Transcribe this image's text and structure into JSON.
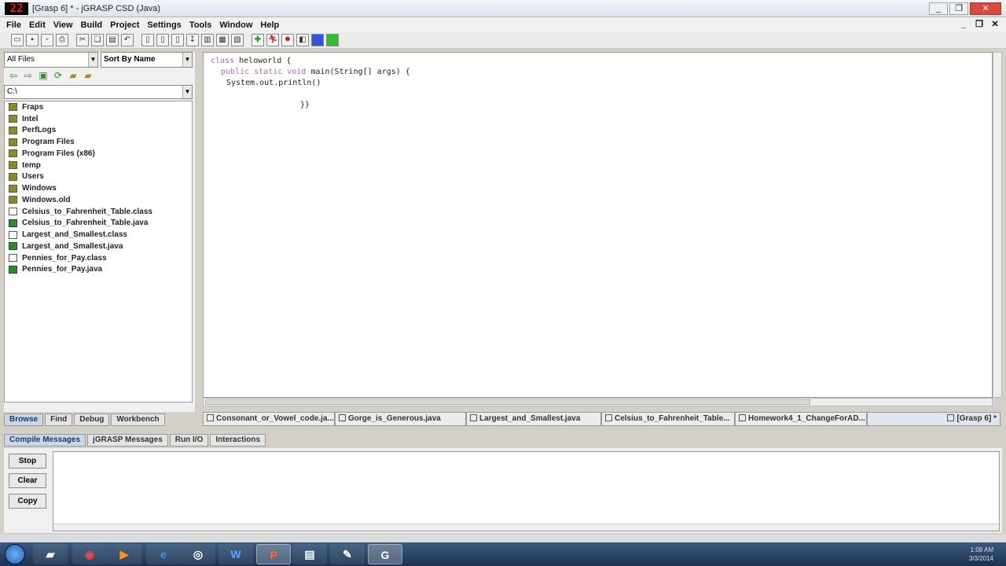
{
  "window": {
    "app_icon_text": "22",
    "title": "[Grasp 6] * - jGRASP CSD (Java)",
    "minimize": "_",
    "restore": "❐",
    "close": "✕"
  },
  "menu": [
    "File",
    "Edit",
    "View",
    "Build",
    "Project",
    "Settings",
    "Tools",
    "Window",
    "Help"
  ],
  "browser": {
    "filter": "All Files",
    "sort": "Sort By Name",
    "path": "C:\\",
    "items": [
      {
        "name": "Fraps",
        "type": "folder"
      },
      {
        "name": "Intel",
        "type": "folder"
      },
      {
        "name": "PerfLogs",
        "type": "folder"
      },
      {
        "name": "Program Files",
        "type": "folder"
      },
      {
        "name": "Program Files (x86)",
        "type": "folder"
      },
      {
        "name": "temp",
        "type": "folder"
      },
      {
        "name": "Users",
        "type": "folder"
      },
      {
        "name": "Windows",
        "type": "folder"
      },
      {
        "name": "Windows.old",
        "type": "folder"
      },
      {
        "name": "Celsius_to_Fahrenheit_Table.class",
        "type": "class"
      },
      {
        "name": "Celsius_to_Fahrenheit_Table.java",
        "type": "java"
      },
      {
        "name": "Largest_and_Smallest.class",
        "type": "class"
      },
      {
        "name": "Largest_and_Smallest.java",
        "type": "java"
      },
      {
        "name": "Pennies_for_Pay.class",
        "type": "class"
      },
      {
        "name": "Pennies_for_Pay.java",
        "type": "java"
      }
    ],
    "tabs": [
      "Browse",
      "Find",
      "Debug",
      "Workbench"
    ]
  },
  "editor": {
    "lines": [
      {
        "kw": "class",
        "rest": " heloworld {"
      },
      {
        "kw": "public static void",
        "rest": " main(String[] args) {"
      },
      {
        "kw": "",
        "rest": "System.out.println()"
      },
      {
        "kw": "",
        "rest": ""
      },
      {
        "kw": "",
        "rest": "}}"
      }
    ]
  },
  "file_tabs": [
    "Consonant_or_Vowel_code.ja...",
    "Gorge_is_Generous.java",
    "Largest_and_Smallest.java",
    "Celsius_to_Fahrenheit_Table...",
    "Homework4_1_ChangeForAD...",
    "[Grasp 6] *"
  ],
  "message_tabs": [
    "Compile Messages",
    "jGRASP Messages",
    "Run I/O",
    "Interactions"
  ],
  "message_buttons": {
    "stop": "Stop",
    "clear": "Clear",
    "copy": "Copy"
  },
  "taskbar": {
    "time": "1:08 AM",
    "date": "3/3/2014"
  },
  "colors": {
    "keyword": "#b06ab0",
    "java_file_icon": "#2e8b2e",
    "folder_icon": "#8a8a2a",
    "active_tab": "#c9d7ea"
  }
}
